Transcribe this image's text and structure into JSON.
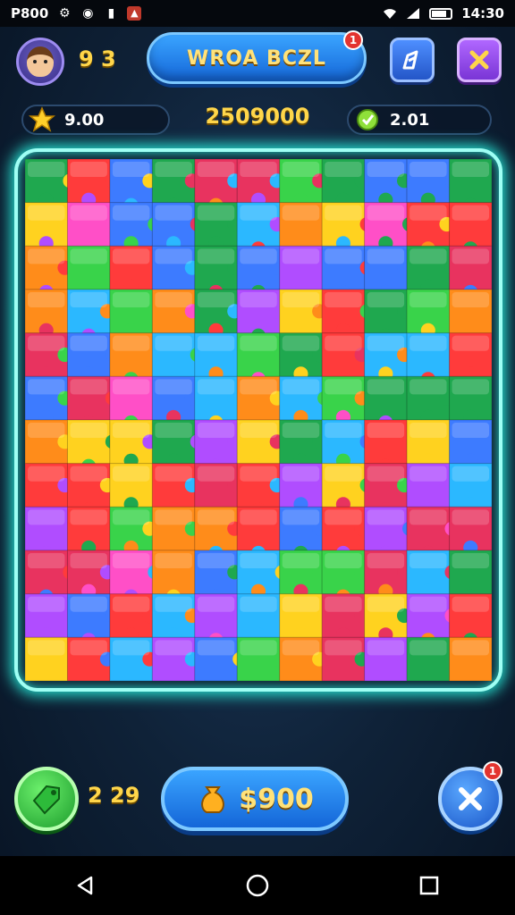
{
  "status_bar": {
    "left_text": "P800",
    "time": "14:30",
    "icons": [
      "settings-icon",
      "record-icon",
      "signal-bars-icon",
      "alert-icon",
      "wifi-icon",
      "cell-signal-icon",
      "battery-icon"
    ]
  },
  "header": {
    "level": "9 3",
    "title": "WROA BCZL",
    "title_badge": "1",
    "buttons": [
      "edit-icon",
      "close-icon"
    ]
  },
  "stats": {
    "stars": "9.00",
    "score": "2509000",
    "gems": "2.01"
  },
  "board": {
    "rows": 12,
    "cols": 11,
    "piece_colors": [
      "#ff3b3b",
      "#ff8c1a",
      "#ffd21f",
      "#39d34a",
      "#1fa84f",
      "#2bb8ff",
      "#3d7bff",
      "#b04dff",
      "#ff4fc7",
      "#e8335f"
    ]
  },
  "footer": {
    "hint_count": "2 29",
    "coins": "$900",
    "close_badge": "1"
  },
  "navbar": {
    "buttons": [
      "back-icon",
      "home-icon",
      "recents-icon"
    ]
  },
  "colors": {
    "frame_glow": "#26e0d0",
    "accent_gold": "#ffd64a",
    "button_blue": "#1466d8"
  }
}
